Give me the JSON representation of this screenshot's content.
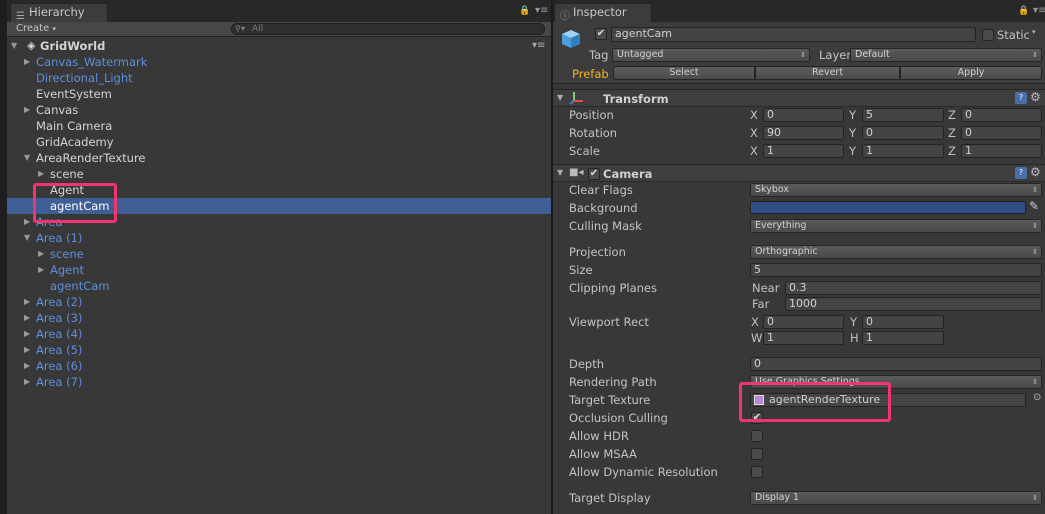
{
  "hierarchy": {
    "tab_label": "Hierarchy",
    "create_label": "Create",
    "search_placeholder": "All",
    "scene_name": "GridWorld",
    "items": [
      {
        "label": "Canvas_Watermark",
        "color": "blue",
        "arrow": "right"
      },
      {
        "label": "Directional_Light",
        "color": "blue",
        "arrow": ""
      },
      {
        "label": "EventSystem",
        "color": "white",
        "arrow": ""
      },
      {
        "label": "Canvas",
        "color": "white",
        "arrow": "right"
      },
      {
        "label": "Main Camera",
        "color": "white",
        "arrow": ""
      },
      {
        "label": "GridAcademy",
        "color": "white",
        "arrow": ""
      },
      {
        "label": "AreaRenderTexture",
        "color": "white",
        "arrow": "down"
      },
      {
        "label": "scene",
        "color": "white",
        "arrow": "right"
      },
      {
        "label": "Agent",
        "color": "white",
        "arrow": ""
      },
      {
        "label": "agentCam",
        "color": "white",
        "arrow": "",
        "selected": true
      },
      {
        "label": "Area",
        "color": "blue",
        "arrow": "right"
      },
      {
        "label": "Area (1)",
        "color": "blue",
        "arrow": "down"
      },
      {
        "label": "scene",
        "color": "blue",
        "arrow": "right"
      },
      {
        "label": "Agent",
        "color": "blue",
        "arrow": "right"
      },
      {
        "label": "agentCam",
        "color": "blue",
        "arrow": ""
      },
      {
        "label": "Area (2)",
        "color": "blue",
        "arrow": "right"
      },
      {
        "label": "Area (3)",
        "color": "blue",
        "arrow": "right"
      },
      {
        "label": "Area (4)",
        "color": "blue",
        "arrow": "right"
      },
      {
        "label": "Area (5)",
        "color": "blue",
        "arrow": "right"
      },
      {
        "label": "Area (6)",
        "color": "blue",
        "arrow": "right"
      },
      {
        "label": "Area (7)",
        "color": "blue",
        "arrow": "right"
      }
    ]
  },
  "inspector": {
    "tab_label": "Inspector",
    "object_name": "agentCam",
    "static_label": "Static",
    "tag_label": "Tag",
    "tag_value": "Untagged",
    "layer_label": "Layer",
    "layer_value": "Default",
    "prefab_label": "Prefab",
    "prefab_buttons": [
      "Select",
      "Revert",
      "Apply"
    ],
    "transform": {
      "title": "Transform",
      "rows": [
        {
          "label": "Position",
          "x": "0",
          "y": "5",
          "z": "0"
        },
        {
          "label": "Rotation",
          "x": "90",
          "y": "0",
          "z": "0"
        },
        {
          "label": "Scale",
          "x": "1",
          "y": "1",
          "z": "1"
        }
      ],
      "axis_x": "X",
      "axis_y": "Y",
      "axis_z": "Z"
    },
    "camera": {
      "title": "Camera",
      "clear_flags_label": "Clear Flags",
      "clear_flags_value": "Skybox",
      "background_label": "Background",
      "background_color": "#2f4f86",
      "culling_mask_label": "Culling Mask",
      "culling_mask_value": "Everything",
      "projection_label": "Projection",
      "projection_value": "Orthographic",
      "size_label": "Size",
      "size_value": "5",
      "clipping_label": "Clipping Planes",
      "near_label": "Near",
      "near_value": "0.3",
      "far_label": "Far",
      "far_value": "1000",
      "viewport_label": "Viewport Rect",
      "vp_x_label": "X",
      "vp_x": "0",
      "vp_y_label": "Y",
      "vp_y": "0",
      "vp_w_label": "W",
      "vp_w": "1",
      "vp_h_label": "H",
      "vp_h": "1",
      "depth_label": "Depth",
      "depth_value": "0",
      "rendering_path_label": "Rendering Path",
      "rendering_path_value": "Use Graphics Settings",
      "target_texture_label": "Target Texture",
      "target_texture_value": "agentRenderTexture",
      "occlusion_label": "Occlusion Culling",
      "hdr_label": "Allow HDR",
      "msaa_label": "Allow MSAA",
      "dynres_label": "Allow Dynamic Resolution",
      "target_display_label": "Target Display",
      "target_display_value": "Display 1"
    }
  },
  "colors": {
    "highlight": "#f3356f",
    "selection": "#3f5e94",
    "prefab_blue": "#5e8fdb"
  }
}
